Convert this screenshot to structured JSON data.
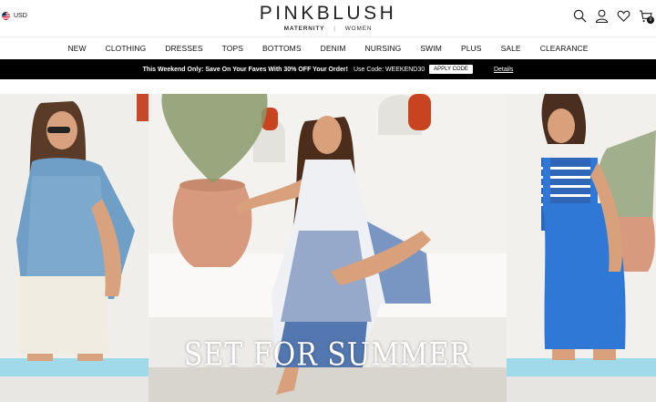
{
  "header": {
    "currency": "USD",
    "brand": "PINKBLUSH",
    "brand_sub_maternity": "MATERNITY",
    "brand_sub_separator": "|",
    "brand_sub_women": "WOMEN",
    "icons": [
      "search-icon",
      "account-icon",
      "wishlist-icon",
      "cart-icon"
    ],
    "cart_count": "0"
  },
  "nav": {
    "items": [
      "NEW",
      "CLOTHING",
      "DRESSES",
      "TOPS",
      "BOTTOMS",
      "DENIM",
      "NURSING",
      "SWIM",
      "PLUS",
      "SALE",
      "CLEARANCE"
    ]
  },
  "promo": {
    "message": "This Weekend Only: Save On Your Faves With 30% OFF Your Order!",
    "code_text": "Use Code: WEEKEND30",
    "apply_label": "APPLY CODE",
    "details_label": "Details"
  },
  "hero": {
    "headline": "SET FOR SUMMER"
  },
  "colors": {
    "promo_bg": "#000000",
    "accent_blue": "#2f6fc4",
    "wall": "#f2f1ee",
    "pool": "#8fd3e6"
  }
}
